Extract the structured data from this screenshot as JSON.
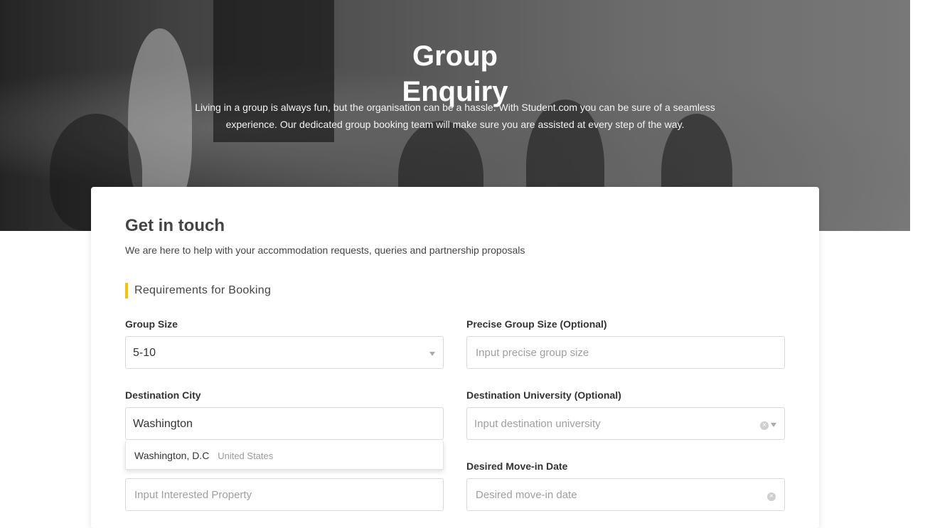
{
  "hero": {
    "title": "Group Enquiry",
    "description": "Living in a group is always fun, but the organisation can be a hassle. With Student.com you can be sure of a seamless experience. Our dedicated group booking team will make sure you are assisted at every step of the way."
  },
  "form": {
    "title": "Get in touch",
    "subtitle": "We are here to help with your accommodation requests, queries and partnership proposals",
    "section_title": "Requirements for Booking",
    "group_size": {
      "label": "Group Size",
      "value": "5-10"
    },
    "precise_group_size": {
      "label": "Precise Group Size (Optional)",
      "placeholder": "Input precise group size"
    },
    "destination_city": {
      "label": "Destination City",
      "value": "Washington"
    },
    "city_suggestion": {
      "city": "Washington, D.C",
      "country": "United States"
    },
    "destination_university": {
      "label": "Destination University (Optional)",
      "placeholder": "Input destination university"
    },
    "interested_property": {
      "placeholder": "Input Interested Property"
    },
    "move_in_date": {
      "label": "Desired Move-in Date",
      "placeholder": "Desired move-in date"
    }
  },
  "icons": {
    "dropdown": "chevron-down-icon",
    "clear": "clear-circle-icon"
  },
  "colors": {
    "accent": "#f5c400"
  }
}
